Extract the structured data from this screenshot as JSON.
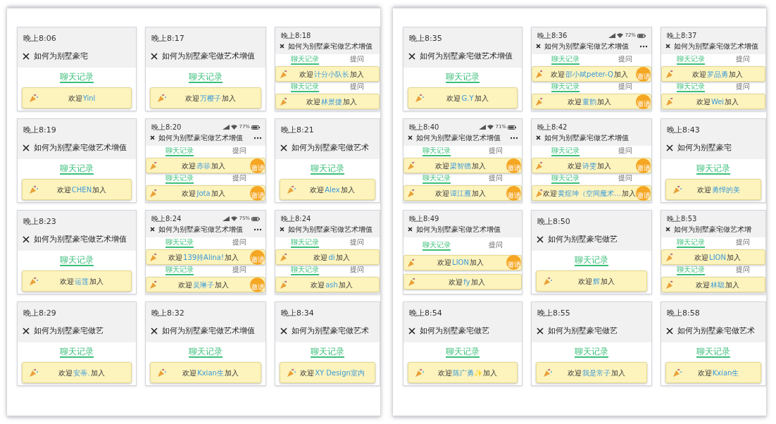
{
  "panels": [
    {
      "tiles": [
        {
          "kind": "large",
          "time": "晚上8:06",
          "title": "如何为别墅豪宅",
          "sections": [
            {
              "tabs": [
                {
                  "label": "聊天记录",
                  "selected": true
                }
              ],
              "banner": {
                "greeting": "欢迎",
                "name": "Yinl"
              }
            }
          ]
        },
        {
          "kind": "large",
          "time": "晚上8:17",
          "title": "如何为别墅豪宅做艺术增值",
          "sections": [
            {
              "tabs": [
                {
                  "label": "聊天记录",
                  "selected": true
                }
              ],
              "banner": {
                "greeting": "欢迎",
                "name": "万樱子",
                "suffix": "加入"
              }
            }
          ]
        },
        {
          "kind": "compact",
          "time": "晚上8:18",
          "title": "如何为别墅豪宅做艺术增值",
          "sections": [
            {
              "tabs": [
                {
                  "label": "聊天记录",
                  "selected": true
                },
                {
                  "label": "提问",
                  "selected": false
                }
              ],
              "banner": {
                "greeting": "欢迎",
                "name": "计分小队长",
                "suffix": "加入"
              }
            },
            {
              "tabs": [
                {
                  "label": "聊天记录",
                  "selected": true
                },
                {
                  "label": "提问",
                  "selected": false
                }
              ],
              "banner": {
                "greeting": "欢迎",
                "name": "林景捷",
                "suffix": "加入"
              }
            }
          ]
        },
        {
          "kind": "large",
          "time": "晚上8:19",
          "title": "如何为别墅豪宅做艺术增值",
          "sections": [
            {
              "tabs": [
                {
                  "label": "聊天记录",
                  "selected": true
                }
              ],
              "banner": {
                "greeting": "欢迎",
                "name": "CHEN",
                "suffix": "加入"
              }
            }
          ]
        },
        {
          "kind": "compact",
          "time": "晚上8:20",
          "title": "如何为别墅豪宅做艺术增值",
          "battery": "77%",
          "menu": true,
          "sections": [
            {
              "tabs": [
                {
                  "label": "聊天记录",
                  "selected": true
                },
                {
                  "label": "提问",
                  "selected": false
                }
              ],
              "banner": {
                "greeting": "欢迎",
                "name": "赤菲",
                "suffix": "加入",
                "invite": true,
                "invite_label": "邀请"
              }
            },
            {
              "tabs": [
                {
                  "label": "聊天记录",
                  "selected": true
                },
                {
                  "label": "提问",
                  "selected": false
                }
              ],
              "banner": {
                "greeting": "欢迎",
                "name": "Jota",
                "suffix": "加入",
                "invite": true,
                "invite_label": "邀请"
              }
            }
          ]
        },
        {
          "kind": "large",
          "time": "晚上8:21",
          "title": "如何为别墅豪宅做艺术",
          "sections": [
            {
              "tabs": [
                {
                  "label": "聊天记录",
                  "selected": true
                }
              ],
              "banner": {
                "greeting": "欢迎",
                "name": "Alex",
                "suffix": "加入"
              }
            }
          ]
        },
        {
          "kind": "large",
          "time": "晚上8:23",
          "title": "如何为别墅豪宅做艺术增值",
          "sections": [
            {
              "tabs": [
                {
                  "label": "聊天记录",
                  "selected": true
                }
              ],
              "banner": {
                "greeting": "欢迎",
                "name": "运莲",
                "suffix": "加入"
              }
            }
          ]
        },
        {
          "kind": "compact",
          "time": "晚上8:24",
          "title": "如何为别墅豪宅做艺术增值",
          "battery": "75%",
          "menu": true,
          "sections": [
            {
              "tabs": [
                {
                  "label": "聊天记录",
                  "selected": true
                },
                {
                  "label": "提问",
                  "selected": false
                }
              ],
              "banner": {
                "greeting": "欢迎",
                "name": "139持Alina!",
                "suffix": "加入",
                "invite": true,
                "invite_label": "邀请"
              }
            },
            {
              "tabs": [
                {
                  "label": "聊天记录",
                  "selected": true
                },
                {
                  "label": "提问",
                  "selected": false
                }
              ],
              "banner": {
                "greeting": "欢迎",
                "name": "吴琳子",
                "suffix": "加入",
                "invite": true,
                "invite_label": "邀请"
              }
            }
          ]
        },
        {
          "kind": "compact",
          "time": "晚上8:24",
          "title": "如何为别墅豪宅做艺术增值",
          "sections": [
            {
              "tabs": [
                {
                  "label": "聊天记录",
                  "selected": true
                },
                {
                  "label": "提问",
                  "selected": false
                }
              ],
              "banner": {
                "greeting": "欢迎",
                "name": "di",
                "suffix": "加入"
              }
            },
            {
              "tabs": [
                {
                  "label": "聊天记录",
                  "selected": true
                },
                {
                  "label": "提问",
                  "selected": false
                }
              ],
              "banner": {
                "greeting": "欢迎",
                "name": "ash",
                "suffix": "加入"
              }
            }
          ]
        },
        {
          "kind": "large",
          "time": "晚上8:29",
          "title": "如何为别墅豪宅做艺",
          "sections": [
            {
              "tabs": [
                {
                  "label": "聊天记录",
                  "selected": true
                }
              ],
              "banner": {
                "greeting": "欢迎",
                "name": "安蒂.",
                "suffix": "加入"
              }
            }
          ]
        },
        {
          "kind": "large",
          "time": "晚上8:32",
          "title": "如何为别墅豪宅做艺术增值",
          "sections": [
            {
              "tabs": [
                {
                  "label": "聊天记录",
                  "selected": true
                }
              ],
              "banner": {
                "greeting": "欢迎",
                "name": "Kxian生",
                "suffix": "加入"
              }
            }
          ]
        },
        {
          "kind": "large",
          "time": "晚上8:34",
          "title": "如何为别墅豪宅做艺术",
          "sections": [
            {
              "tabs": [
                {
                  "label": "聊天记录",
                  "selected": true
                }
              ],
              "banner": {
                "greeting": "欢迎",
                "name": "XY Design室内"
              }
            }
          ]
        }
      ]
    },
    {
      "tiles": [
        {
          "kind": "large",
          "time": "晚上8:35",
          "title": "如何为别墅豪宅做艺术增值",
          "sections": [
            {
              "tabs": [
                {
                  "label": "聊天记录",
                  "selected": true
                }
              ],
              "banner": {
                "greeting": "欢迎",
                "name": "G.Y",
                "suffix": "加入"
              }
            }
          ]
        },
        {
          "kind": "compact",
          "time": "晚上8:36",
          "title": "如何为别墅豪宅做艺术增值",
          "battery": "72%",
          "menu": true,
          "sections": [
            {
              "tabs": [
                {
                  "label": "聊天记录",
                  "selected": true
                },
                {
                  "label": "提问",
                  "selected": false
                }
              ],
              "banner": {
                "greeting": "欢迎",
                "name": "邵小斌peter-Q",
                "suffix": "加入",
                "invite": true,
                "invite_label": "邀请"
              }
            },
            {
              "tabs": [
                {
                  "label": "聊天记录",
                  "selected": true
                },
                {
                  "label": "提问",
                  "selected": false
                }
              ],
              "banner": {
                "greeting": "欢迎",
                "name": "董韵",
                "suffix": "加入",
                "invite": true,
                "invite_label": "邀请"
              }
            }
          ]
        },
        {
          "kind": "compact",
          "time": "晚上8:37",
          "title": "如何为别墅豪宅做艺术增值",
          "sections": [
            {
              "tabs": [
                {
                  "label": "聊天记录",
                  "selected": true
                },
                {
                  "label": "提问",
                  "selected": false
                }
              ],
              "banner": {
                "greeting": "欢迎",
                "name": "罗品勇",
                "suffix": "加入"
              }
            },
            {
              "tabs": [
                {
                  "label": "聊天记录",
                  "selected": true
                },
                {
                  "label": "提问",
                  "selected": false
                }
              ],
              "banner": {
                "greeting": "欢迎",
                "name": "Wei",
                "suffix": "加入"
              }
            }
          ]
        },
        {
          "kind": "compact",
          "time": "晚上8:40",
          "title": "如何为别墅豪宅做艺术增值",
          "battery": "71%",
          "menu": true,
          "sections": [
            {
              "tabs": [
                {
                  "label": "聊天记录",
                  "selected": true
                },
                {
                  "label": "提问",
                  "selected": false
                }
              ],
              "banner": {
                "greeting": "欢迎",
                "name": "梁智德",
                "suffix": "加入",
                "invite": true,
                "invite_label": "邀请"
              }
            },
            {
              "tabs": [
                {
                  "label": "聊天记录",
                  "selected": true
                },
                {
                  "label": "提问",
                  "selected": false
                }
              ],
              "banner": {
                "greeting": "欢迎",
                "name": "谭江雁",
                "suffix": "加入",
                "invite": true,
                "invite_label": "邀请"
              }
            }
          ]
        },
        {
          "kind": "compact",
          "time": "晚上8:42",
          "title": "如何为别墅豪宅做艺术增值",
          "sections": [
            {
              "tabs": [
                {
                  "label": "聊天记录",
                  "selected": true
                },
                {
                  "label": "提问",
                  "selected": false
                }
              ],
              "banner": {
                "greeting": "欢迎",
                "name": "诗雯",
                "suffix": "加入",
                "invite": true,
                "invite_label": "邀请"
              }
            },
            {
              "tabs": [
                {
                  "label": "聊天记录",
                  "selected": true
                },
                {
                  "label": "提问",
                  "selected": false
                }
              ],
              "banner": {
                "greeting": "欢迎",
                "name": "黄煜坤（空间魔术...",
                "suffix": "加入",
                "invite": true,
                "invite_label": "邀请"
              }
            }
          ]
        },
        {
          "kind": "large",
          "time": "晚上8:43",
          "title": "如何为别墅豪宅",
          "sections": [
            {
              "tabs": [
                {
                  "label": "聊天记录",
                  "selected": true
                }
              ],
              "banner": {
                "greeting": "欢迎",
                "name": "勇悍的美"
              }
            }
          ]
        },
        {
          "kind": "compact",
          "time": "晚上8:49",
          "title": "如何为别墅豪宅做艺术增值",
          "sections": [
            {
              "tabs": [
                {
                  "label": "聊天记录",
                  "selected": true
                },
                {
                  "label": "提问",
                  "selected": false
                }
              ],
              "banner": {
                "greeting": "欢迎",
                "name": "LION",
                "suffix": "加入",
                "invite": true,
                "invite_label": "邀请"
              }
            },
            {
              "banner": {
                "greeting": "欢迎",
                "name": "fy",
                "suffix": "加入"
              }
            }
          ]
        },
        {
          "kind": "large",
          "time": "晚上8:50",
          "title": "如何为别墅豪宅做艺",
          "sections": [
            {
              "tabs": [
                {
                  "label": "聊天记录",
                  "selected": true
                }
              ],
              "banner": {
                "greeting": "欢迎",
                "name": "辉",
                "suffix": "加入"
              }
            }
          ]
        },
        {
          "kind": "compact",
          "time": "晚上8:53",
          "title": "如何为别墅豪宅做艺术增",
          "sections": [
            {
              "tabs": [
                {
                  "label": "聊天记录",
                  "selected": true
                },
                {
                  "label": "提问",
                  "selected": false
                }
              ],
              "banner": {
                "greeting": "欢迎",
                "name": "LION",
                "suffix": "加入"
              }
            },
            {
              "tabs": [
                {
                  "label": "聊天记录",
                  "selected": true
                },
                {
                  "label": "提问",
                  "selected": false
                }
              ],
              "banner": {
                "greeting": "欢迎",
                "name": "林聪",
                "suffix": "加入"
              }
            }
          ]
        },
        {
          "kind": "large",
          "time": "晚上8:54",
          "title": "如何为别墅豪宅做艺",
          "sections": [
            {
              "tabs": [
                {
                  "label": "聊天记录",
                  "selected": true
                }
              ],
              "banner": {
                "greeting": "欢迎",
                "name": "陈广勇✨",
                "suffix": "加入"
              }
            }
          ]
        },
        {
          "kind": "large",
          "time": "晚上8:55",
          "title": "如何为别墅豪宅做艺",
          "sections": [
            {
              "tabs": [
                {
                  "label": "聊天记录",
                  "selected": true
                }
              ],
              "banner": {
                "greeting": "欢迎",
                "name": "我是常子",
                "suffix": "加入"
              }
            }
          ]
        },
        {
          "kind": "large",
          "time": "晚上8:58",
          "title": "如何为别墅豪宅做艺术",
          "sections": [
            {
              "tabs": [
                {
                  "label": "聊天记录",
                  "selected": true
                }
              ],
              "banner": {
                "greeting": "欢迎",
                "name": "Kxian生"
              }
            }
          ]
        }
      ]
    }
  ]
}
